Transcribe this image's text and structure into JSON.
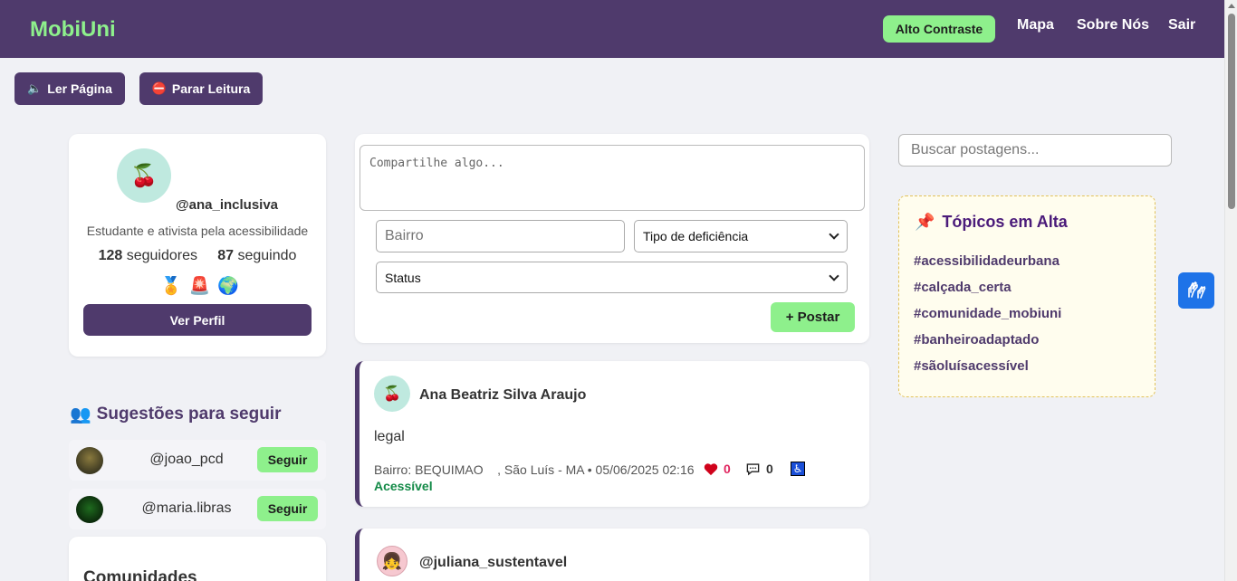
{
  "header": {
    "brand": "MobiUni",
    "contrast_button": "Alto Contraste",
    "nav": [
      "Mapa",
      "Sobre Nós",
      "Sair"
    ]
  },
  "reader": {
    "read_label": "Ler Página",
    "read_icon": "🔈",
    "stop_label": "Parar Leitura",
    "stop_icon": "⛔"
  },
  "profile": {
    "avatar_emoji": "🍒",
    "handle": "@ana_inclusiva",
    "bio": "Estudante e ativista pela acessibilidade",
    "followers_count": "128",
    "followers_label": "seguidores",
    "following_count": "87",
    "following_label": "seguindo",
    "badges": [
      "🏅",
      "🚨",
      "🌍"
    ],
    "view_button": "Ver Perfil"
  },
  "suggestions": {
    "title": "Sugestões para seguir",
    "title_icon": "👥",
    "items": [
      {
        "handle": "@joao_pcd",
        "button": "Seguir"
      },
      {
        "handle": "@maria.libras",
        "button": "Seguir"
      }
    ]
  },
  "communities": {
    "title": "Comunidades"
  },
  "composer": {
    "placeholder": "Compartilhe algo...",
    "bairro_placeholder": "Bairro",
    "deficiency_select": "Tipo de deficiência",
    "status_select": "Status",
    "post_button": "+ Postar"
  },
  "posts": [
    {
      "avatar_emoji": "🍒",
      "author": "Ana Beatriz Silva Araujo",
      "text": "legal",
      "meta": "Bairro: BEQUIMAO    , São Luís - MA • 05/06/2025 02:16",
      "separator": "•",
      "likes": "0",
      "comments": "0",
      "status": "Acessível",
      "accessibility_icon": "♿"
    },
    {
      "avatar_emoji": "👧",
      "author": "@juliana_sustentavel"
    }
  ],
  "search": {
    "placeholder": "Buscar postagens..."
  },
  "trending": {
    "title": "Tópicos em Alta",
    "icon": "📌",
    "tags": [
      "#acessibilidadeurbana",
      "#calçada_certa",
      "#comunidade_mobiuni",
      "#banheiroadaptado",
      "#sãoluísacessível"
    ]
  },
  "colors": {
    "primary": "#4f3a6c",
    "accent": "#8ef08c",
    "accessible": "#138a47",
    "like": "#e0245e",
    "vlibras": "#1e73e8"
  }
}
